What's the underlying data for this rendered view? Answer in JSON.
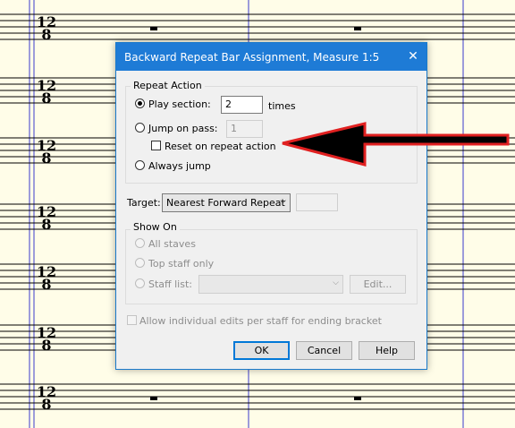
{
  "score": {
    "time_signature_top": "12",
    "time_signature_bottom": "8"
  },
  "dialog": {
    "title": "Backward Repeat Bar Assignment, Measure 1:5",
    "close_glyph": "✕",
    "repeat_action": {
      "group_label": "Repeat Action",
      "play_section_label": "Play section:",
      "play_section_value": "2",
      "times_label": "times",
      "jump_on_pass_label": "Jump on pass:",
      "jump_on_pass_value": "1",
      "reset_label": "Reset on repeat action",
      "always_jump_label": "Always jump",
      "selected": "play_section"
    },
    "target": {
      "label": "Target:",
      "selected": "Nearest Forward Repeat",
      "extra_value": ""
    },
    "show_on": {
      "group_label": "Show On",
      "all_staves_label": "All staves",
      "top_staff_label": "Top staff only",
      "staff_list_label": "Staff list:",
      "staff_list_value": "",
      "edit_label": "Edit..."
    },
    "allow_edits_label": "Allow individual edits per staff for ending bracket",
    "buttons": {
      "ok": "OK",
      "cancel": "Cancel",
      "help": "Help"
    }
  },
  "annotation": {
    "arrow_color": "#e02020",
    "arrow_fill": "#000000"
  }
}
